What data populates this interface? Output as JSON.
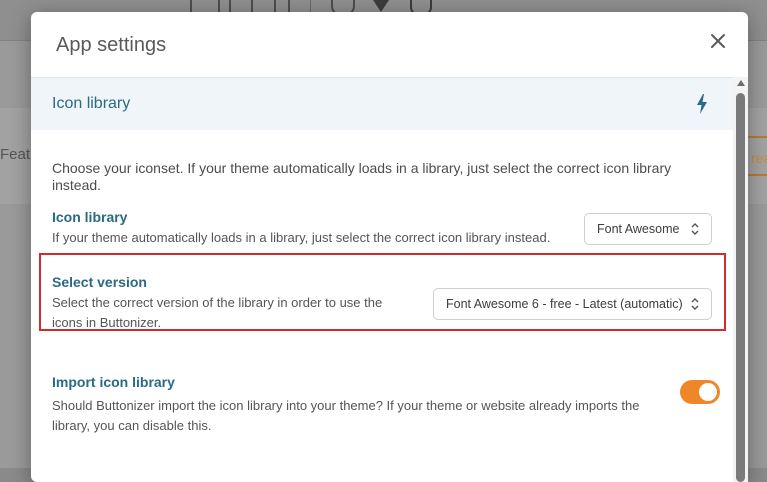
{
  "modal": {
    "title": "App settings"
  },
  "background": {
    "left_text": "Feat",
    "right_text": "rea"
  },
  "section": {
    "title": "Icon library",
    "icon": "bolt-icon"
  },
  "intro_text": "Choose your iconset. If your theme automatically loads in a library, just select the correct icon library instead.",
  "settings": {
    "icon_library": {
      "label": "Icon library",
      "description": "If your theme automatically loads in a library, just select the correct icon library instead.",
      "selected": "Font Awesome"
    },
    "select_version": {
      "label": "Select version",
      "description": "Select the correct version of the library in order to use the icons in Buttonizer.",
      "selected": "Font Awesome 6 - free - Latest (automatic)"
    },
    "import_icon_library": {
      "label": "Import icon library",
      "description": "Should Buttonizer import the icon library into your theme? If your theme or website already imports the library, you can disable this.",
      "enabled": true
    }
  },
  "colors": {
    "accent": "#2b6a84",
    "toggle_on": "#f0862a",
    "highlight": "#d42a2a"
  }
}
